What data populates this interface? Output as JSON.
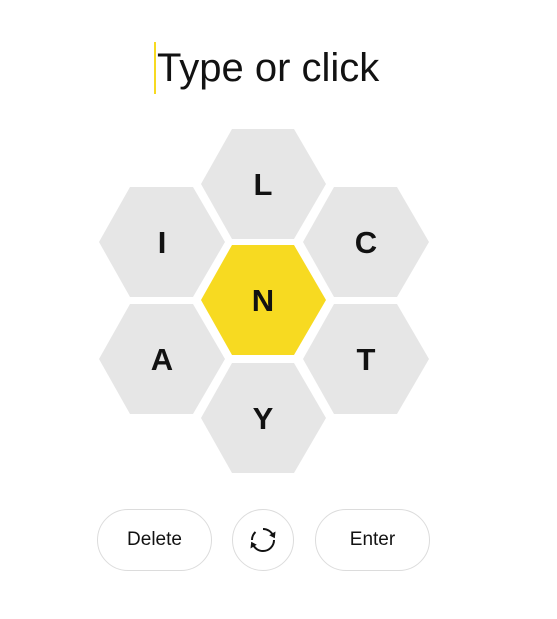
{
  "input": {
    "placeholder": "Type or click"
  },
  "hive": {
    "center_letter": "N",
    "outer_letters": [
      "L",
      "C",
      "T",
      "Y",
      "A",
      "I"
    ],
    "colors": {
      "center": "#f7da21",
      "outer": "#e6e6e6",
      "letter": "#121212"
    }
  },
  "controls": {
    "delete_label": "Delete",
    "shuffle_icon": "shuffle-icon",
    "enter_label": "Enter"
  }
}
